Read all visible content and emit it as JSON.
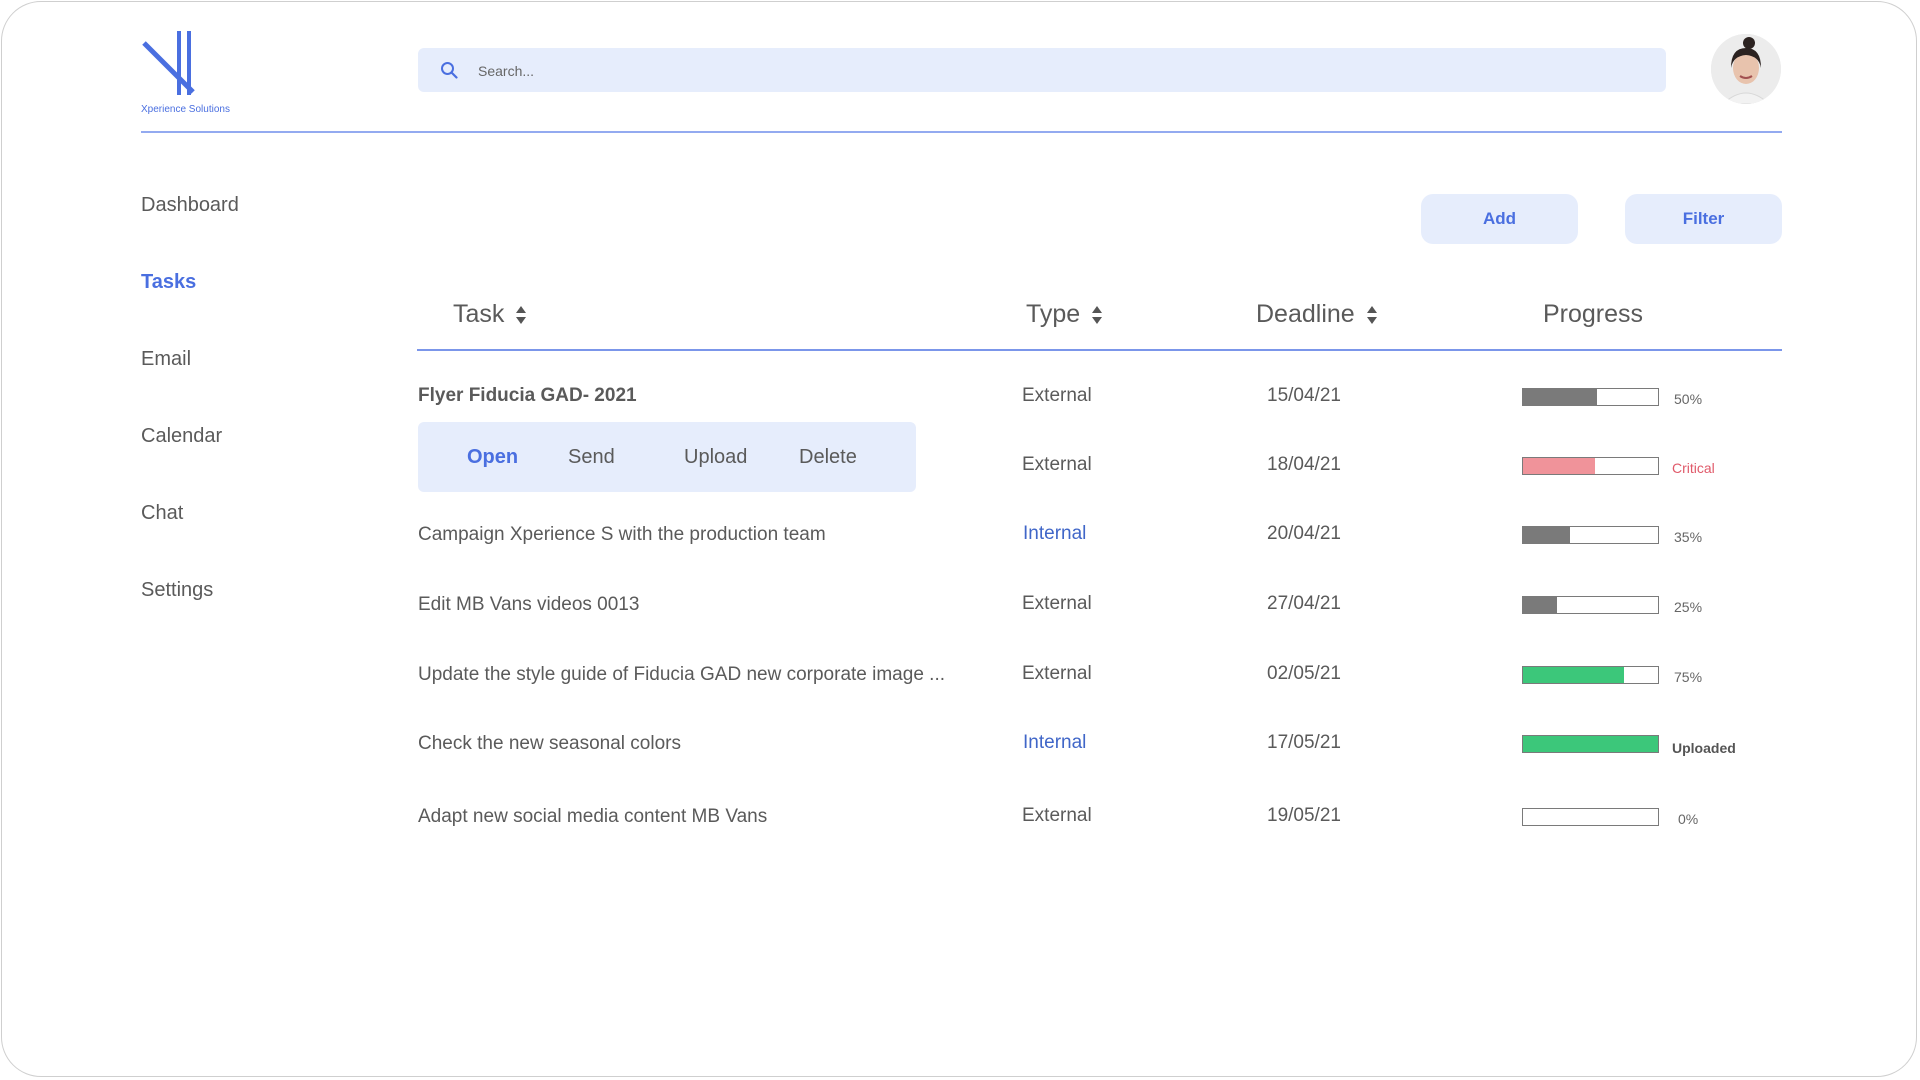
{
  "brand": {
    "name": "Xperience Solutions",
    "accent": "#4a6fe0"
  },
  "search": {
    "placeholder": "Search..."
  },
  "sidebar": {
    "items": [
      {
        "label": "Dashboard",
        "active": false
      },
      {
        "label": "Tasks",
        "active": true
      },
      {
        "label": "Email",
        "active": false
      },
      {
        "label": "Calendar",
        "active": false
      },
      {
        "label": "Chat",
        "active": false
      },
      {
        "label": "Settings",
        "active": false
      }
    ]
  },
  "toolbar": {
    "add_label": "Add",
    "filter_label": "Filter"
  },
  "table": {
    "headers": {
      "task": "Task",
      "type": "Type",
      "deadline": "Deadline",
      "progress": "Progress"
    },
    "rows": [
      {
        "task": "Flyer Fiducia GAD- 2021",
        "type": "External",
        "deadline": "15/04/21",
        "progress": 0.55,
        "label": "50%",
        "bar_color": "#7a7a7a"
      },
      {
        "task": "",
        "type": "External",
        "deadline": "18/04/21",
        "progress": 0.53,
        "label": "Critical",
        "bar_color": "#f0939a"
      },
      {
        "task": "Campaign  Xperience S with the production team",
        "type": "Internal",
        "deadline": "20/04/21",
        "progress": 0.35,
        "label": "35%",
        "bar_color": "#7a7a7a"
      },
      {
        "task": "Edit MB Vans videos 0013",
        "type": "External",
        "deadline": "27/04/21",
        "progress": 0.25,
        "label": "25%",
        "bar_color": "#7a7a7a"
      },
      {
        "task": "Update the style guide of Fiducia GAD new corporate image ...",
        "type": "External",
        "deadline": "02/05/21",
        "progress": 0.75,
        "label": "75%",
        "bar_color": "#3cc77a"
      },
      {
        "task": "Check the new seasonal colors",
        "type": "Internal",
        "deadline": "17/05/21",
        "progress": 1.0,
        "label": "Uploaded",
        "bar_color": "#3cc77a"
      },
      {
        "task": "Adapt new social media content MB Vans",
        "type": "External",
        "deadline": "19/05/21",
        "progress": 0.0,
        "label": "0%",
        "bar_color": "#7a7a7a"
      }
    ]
  },
  "row_actions": {
    "open": "Open",
    "send": "Send",
    "upload": "Upload",
    "delete": "Delete"
  },
  "icons": {
    "search": "search-icon",
    "sort": "sort-icon",
    "avatar": "user-avatar"
  }
}
